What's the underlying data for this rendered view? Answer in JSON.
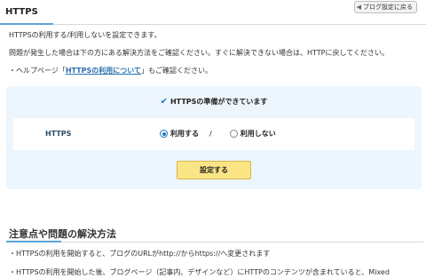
{
  "header": {
    "title": "HTTPS",
    "back_button": "ブログ設定に戻る"
  },
  "intro": {
    "line1": "HTTPSの利用する/利用しないを設定できます。",
    "line2": "問題が発生した場合は下の方にある解決方法をご確認ください。すぐに解決できない場合は、HTTPに戻してください。",
    "help_prefix": "・ヘルプページ「",
    "help_link": "HTTPSの利用について",
    "help_suffix": "」もご確認ください。"
  },
  "panel": {
    "status": "HTTPSの準備ができています",
    "row_label": "HTTPS",
    "option_use": "利用する",
    "separator": "/",
    "option_no": "利用しない",
    "selected": "利用する",
    "submit_label": "設定する"
  },
  "notes": {
    "title": "注意点や問題の解決方法",
    "items": [
      "・HTTPSの利用を開始すると、ブログのURLがhttp://からhttps://へ変更されます",
      "・HTTPSの利用を開始した後、ブログページ（記事内、デザインなど）にHTTPのコンテンツが含まれていると、Mixed"
    ]
  },
  "colors": {
    "accent": "#5aa6d6",
    "panel_bg": "#eef6fd",
    "button_bg": "#fbe484",
    "link": "#2a6fb0"
  }
}
